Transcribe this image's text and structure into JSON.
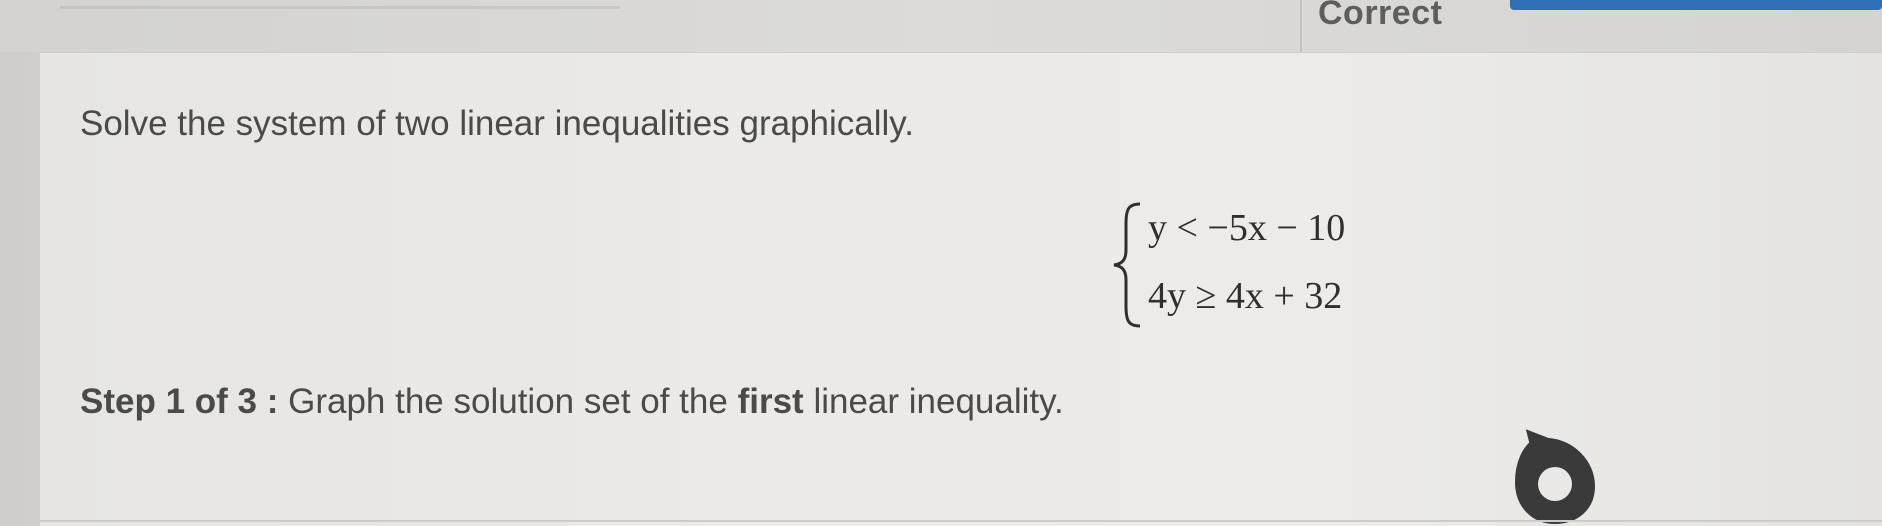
{
  "header": {
    "status_label": "Correct",
    "progress_color": "#2f6fb6"
  },
  "question": {
    "prompt": "Solve the system of two linear inequalities graphically.",
    "system": {
      "inequality_1": "y < −5x − 10",
      "inequality_2": "4y ≥ 4x + 32"
    },
    "step": {
      "label": "Step 1 of 3 :",
      "text_before": "Graph the solution set of the",
      "emphasis": "first",
      "text_after": "linear inequality."
    }
  },
  "icons": {
    "cursor": "pointer-cursor-icon"
  }
}
